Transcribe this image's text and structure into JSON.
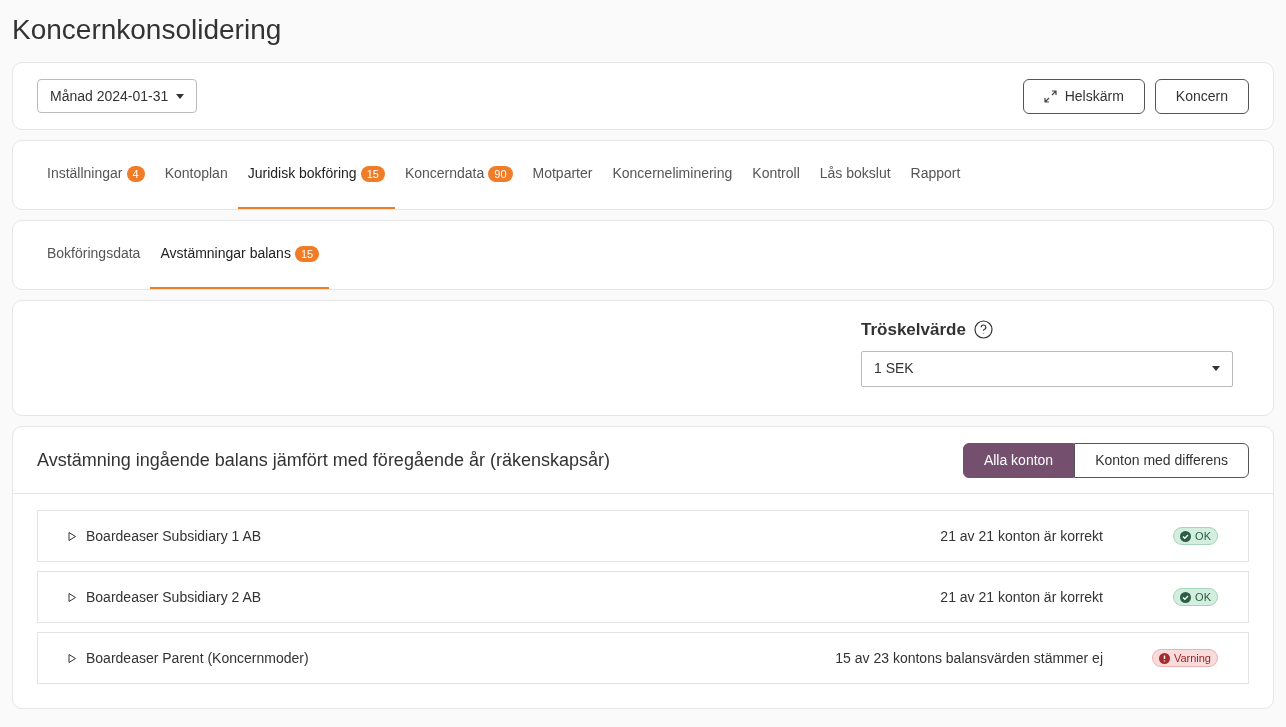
{
  "title": "Koncernkonsolidering",
  "period": {
    "value": "Månad 2024-01-31"
  },
  "header_buttons": [
    {
      "label": "Helskärm",
      "kind": "fullscreen"
    },
    {
      "label": "Koncern",
      "kind": "plain"
    }
  ],
  "tabs": [
    {
      "label": "Inställningar",
      "badge": "4",
      "selected": false
    },
    {
      "label": "Kontoplan",
      "selected": false
    },
    {
      "label": "Juridisk bokföring",
      "badge": "15",
      "selected": true
    },
    {
      "label": "Koncerndata",
      "badge": "90",
      "selected": false
    },
    {
      "label": "Motparter",
      "selected": false
    },
    {
      "label": "Koncerneliminering",
      "selected": false
    },
    {
      "label": "Kontroll",
      "selected": false
    },
    {
      "label": "Lås bokslut",
      "selected": false
    },
    {
      "label": "Rapport",
      "selected": false
    }
  ],
  "subtabs": [
    {
      "label": "Bokföringsdata",
      "selected": false
    },
    {
      "label": "Avstämningar balans",
      "badge": "15",
      "selected": true
    }
  ],
  "threshold": {
    "label": "Tröskelvärde",
    "value": "1 SEK"
  },
  "reconciliation": {
    "title": "Avstämning ingående balans jämfört med föregående år (räkenskapsår)",
    "filters": [
      {
        "label": "Alla konton",
        "selected": true
      },
      {
        "label": "Konton med differens",
        "selected": false
      }
    ],
    "rows": [
      {
        "name": "Boardeaser Subsidiary 1 AB",
        "expanded": false,
        "summary": "21 av 21 konton är korrekt",
        "status": {
          "kind": "ok",
          "label": "OK"
        }
      },
      {
        "name": "Boardeaser Subsidiary 2 AB",
        "expanded": false,
        "summary": "21 av 21 konton är korrekt",
        "status": {
          "kind": "ok",
          "label": "OK"
        }
      },
      {
        "name": "Boardeaser Parent (Koncernmoder)",
        "expanded": false,
        "summary": "15 av 23 kontons balansvärden stämmer ej",
        "status": {
          "kind": "warning",
          "label": "Varning"
        }
      }
    ]
  }
}
